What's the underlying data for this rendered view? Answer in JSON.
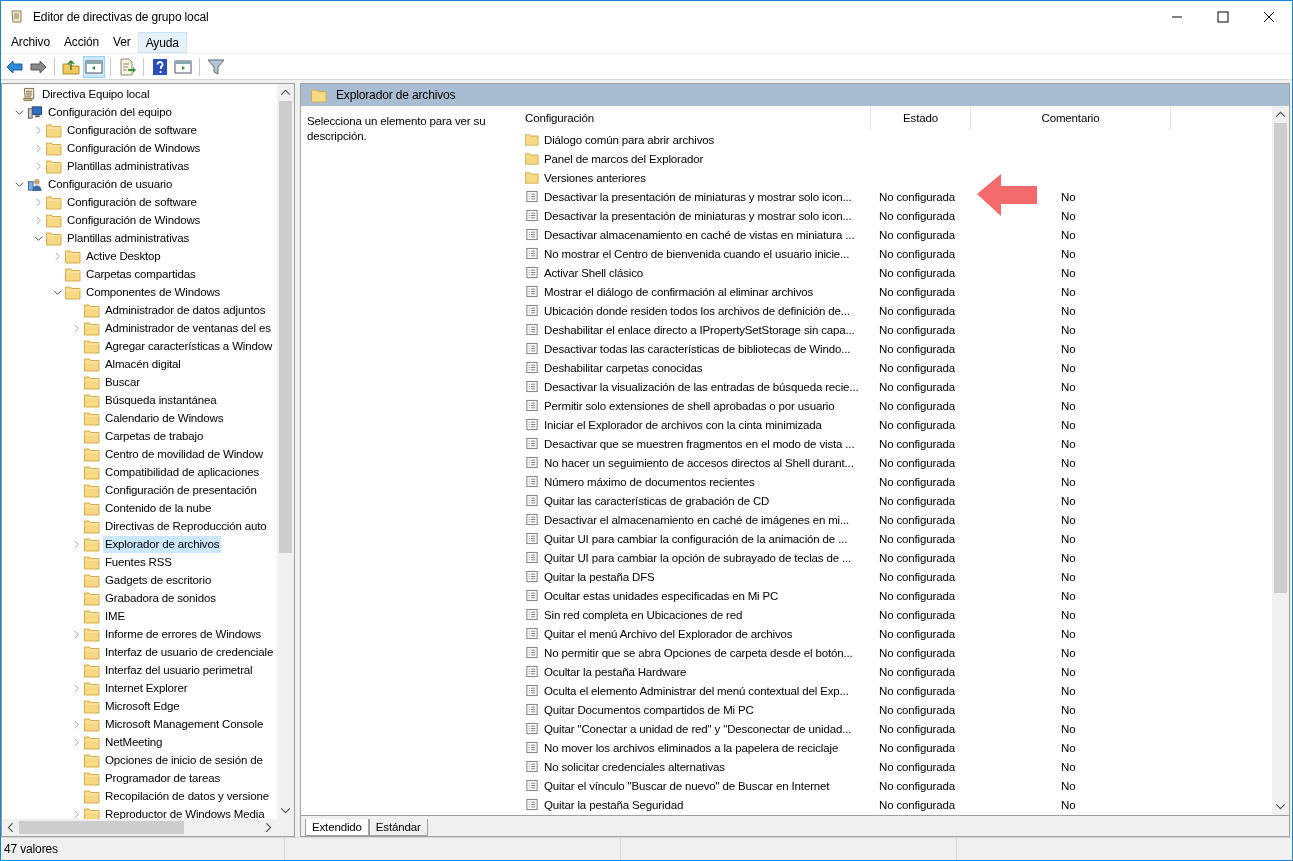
{
  "window": {
    "title": "Editor de directivas de grupo local"
  },
  "menu": [
    {
      "label": "Archivo",
      "highlighted": false
    },
    {
      "label": "Acción",
      "highlighted": false
    },
    {
      "label": "Ver",
      "highlighted": false
    },
    {
      "label": "Ayuda",
      "highlighted": true
    }
  ],
  "toolbar": [
    [
      {
        "pressed": false
      },
      {
        "pressed": false
      }
    ],
    [
      {
        "pressed": false
      },
      {
        "pressed": true
      }
    ],
    [
      {
        "pressed": false
      }
    ],
    [
      {
        "pressed": false
      },
      {
        "pressed": false
      }
    ],
    [
      {
        "pressed": false
      }
    ]
  ],
  "tree": [
    {
      "label": "Directiva Equipo local",
      "kind": "scroll",
      "selected": false,
      "children": [
        {
          "label": "Configuración del equipo",
          "kind": "computer",
          "expanded": true,
          "selected": false,
          "children": [
            {
              "label": "Configuración de software",
              "kind": "folder",
              "expanded": false,
              "selected": false
            },
            {
              "label": "Configuración de Windows",
              "kind": "folder",
              "expanded": false,
              "selected": false
            },
            {
              "label": "Plantillas administrativas",
              "kind": "folder",
              "expanded": false,
              "selected": false
            }
          ]
        },
        {
          "label": "Configuración de usuario",
          "kind": "user",
          "expanded": true,
          "selected": false,
          "children": [
            {
              "label": "Configuración de software",
              "kind": "folder",
              "expanded": false,
              "selected": false
            },
            {
              "label": "Configuración de Windows",
              "kind": "folder",
              "expanded": false,
              "selected": false
            },
            {
              "label": "Plantillas administrativas",
              "kind": "folder",
              "expanded": true,
              "selected": false,
              "children": [
                {
                  "label": "Active Desktop",
                  "kind": "folder",
                  "expanded": false,
                  "selected": false
                },
                {
                  "label": "Carpetas compartidas",
                  "kind": "folder",
                  "selected": false
                },
                {
                  "label": "Componentes de Windows",
                  "kind": "folder",
                  "expanded": true,
                  "selected": false,
                  "children": [
                    {
                      "label": "Administrador de datos adjuntos",
                      "kind": "folder",
                      "selected": false
                    },
                    {
                      "label": "Administrador de ventanas del es",
                      "kind": "folder",
                      "expanded": false,
                      "selected": false
                    },
                    {
                      "label": "Agregar características a Window",
                      "kind": "folder",
                      "selected": false
                    },
                    {
                      "label": "Almacén digital",
                      "kind": "folder",
                      "selected": false
                    },
                    {
                      "label": "Buscar",
                      "kind": "folder",
                      "selected": false
                    },
                    {
                      "label": "Búsqueda instantánea",
                      "kind": "folder",
                      "selected": false
                    },
                    {
                      "label": "Calendario de Windows",
                      "kind": "folder",
                      "selected": false
                    },
                    {
                      "label": "Carpetas de trabajo",
                      "kind": "folder",
                      "selected": false
                    },
                    {
                      "label": "Centro de movilidad de Window",
                      "kind": "folder",
                      "selected": false
                    },
                    {
                      "label": "Compatibilidad de aplicaciones",
                      "kind": "folder",
                      "selected": false
                    },
                    {
                      "label": "Configuración de presentación",
                      "kind": "folder",
                      "selected": false
                    },
                    {
                      "label": "Contenido de la nube",
                      "kind": "folder",
                      "selected": false
                    },
                    {
                      "label": "Directivas de Reproducción auto",
                      "kind": "folder",
                      "selected": false
                    },
                    {
                      "label": "Explorador de archivos",
                      "kind": "folder",
                      "expanded": false,
                      "selected": true
                    },
                    {
                      "label": "Fuentes RSS",
                      "kind": "folder",
                      "selected": false
                    },
                    {
                      "label": "Gadgets de escritorio",
                      "kind": "folder",
                      "selected": false
                    },
                    {
                      "label": "Grabadora de sonidos",
                      "kind": "folder",
                      "selected": false
                    },
                    {
                      "label": "IME",
                      "kind": "folder",
                      "selected": false
                    },
                    {
                      "label": "Informe de errores de Windows",
                      "kind": "folder",
                      "expanded": false,
                      "selected": false
                    },
                    {
                      "label": "Interfaz de usuario de credenciale",
                      "kind": "folder",
                      "selected": false
                    },
                    {
                      "label": "Interfaz del usuario perimetral",
                      "kind": "folder",
                      "selected": false
                    },
                    {
                      "label": "Internet Explorer",
                      "kind": "folder",
                      "expanded": false,
                      "selected": false
                    },
                    {
                      "label": "Microsoft Edge",
                      "kind": "folder",
                      "selected": false
                    },
                    {
                      "label": "Microsoft Management Console",
                      "kind": "folder",
                      "expanded": false,
                      "selected": false
                    },
                    {
                      "label": "NetMeeting",
                      "kind": "folder",
                      "expanded": false,
                      "selected": false
                    },
                    {
                      "label": "Opciones de inicio de sesión de",
                      "kind": "folder",
                      "selected": false
                    },
                    {
                      "label": "Programador de tareas",
                      "kind": "folder",
                      "selected": false
                    },
                    {
                      "label": "Recopilación de datos y versione",
                      "kind": "folder",
                      "selected": false
                    },
                    {
                      "label": "Reproductor de Windows Media",
                      "kind": "folder",
                      "expanded": false,
                      "selected": false
                    }
                  ]
                }
              ]
            }
          ]
        }
      ]
    }
  ],
  "details": {
    "title": "Explorador de archivos",
    "description": "Selecciona un elemento para ver su descripción.",
    "columns": [
      "Configuración",
      "Estado",
      "Comentario"
    ],
    "rows": [
      {
        "kind": "folder",
        "name": "Diálogo común para abrir archivos"
      },
      {
        "kind": "folder",
        "name": "Panel de marcos del Explorador"
      },
      {
        "kind": "folder",
        "name": "Versiones anteriores"
      },
      {
        "kind": "policy",
        "name": "Desactivar la presentación de miniaturas y mostrar solo icon...",
        "state": "No configurada",
        "comment": "No"
      },
      {
        "kind": "policy",
        "name": "Desactivar la presentación de miniaturas y mostrar solo icon...",
        "state": "No configurada",
        "comment": "No"
      },
      {
        "kind": "policy",
        "name": "Desactivar almacenamiento en caché de vistas en miniatura ...",
        "state": "No configurada",
        "comment": "No"
      },
      {
        "kind": "policy",
        "name": "No mostrar el Centro de bienvenida cuando el usuario inicie...",
        "state": "No configurada",
        "comment": "No"
      },
      {
        "kind": "policy",
        "name": "Activar Shell clásico",
        "state": "No configurada",
        "comment": "No"
      },
      {
        "kind": "policy",
        "name": "Mostrar el diálogo de confirmación al eliminar archivos",
        "state": "No configurada",
        "comment": "No"
      },
      {
        "kind": "policy",
        "name": "Ubicación donde residen todos los archivos de definición de...",
        "state": "No configurada",
        "comment": "No"
      },
      {
        "kind": "policy",
        "name": "Deshabilitar el enlace directo a IPropertySetStorage sin capa...",
        "state": "No configurada",
        "comment": "No"
      },
      {
        "kind": "policy",
        "name": "Desactivar todas las características de bibliotecas de Windo...",
        "state": "No configurada",
        "comment": "No"
      },
      {
        "kind": "policy",
        "name": "Deshabilitar carpetas conocidas",
        "state": "No configurada",
        "comment": "No"
      },
      {
        "kind": "policy",
        "name": "Desactivar la visualización de las entradas de búsqueda recie...",
        "state": "No configurada",
        "comment": "No"
      },
      {
        "kind": "policy",
        "name": "Permitir solo extensiones de shell aprobadas o por usuario",
        "state": "No configurada",
        "comment": "No"
      },
      {
        "kind": "policy",
        "name": "Iniciar el Explorador de archivos con la cinta minimizada",
        "state": "No configurada",
        "comment": "No"
      },
      {
        "kind": "policy",
        "name": "Desactivar que se muestren fragmentos en el modo de vista ...",
        "state": "No configurada",
        "comment": "No"
      },
      {
        "kind": "policy",
        "name": "No hacer un seguimiento de accesos directos al Shell durant...",
        "state": "No configurada",
        "comment": "No"
      },
      {
        "kind": "policy",
        "name": "Número máximo de documentos recientes",
        "state": "No configurada",
        "comment": "No"
      },
      {
        "kind": "policy",
        "name": "Quitar las características de grabación de CD",
        "state": "No configurada",
        "comment": "No"
      },
      {
        "kind": "policy",
        "name": "Desactivar el almacenamiento en caché de imágenes en mi...",
        "state": "No configurada",
        "comment": "No"
      },
      {
        "kind": "policy",
        "name": "Quitar UI para cambiar la configuración de la animación de ...",
        "state": "No configurada",
        "comment": "No"
      },
      {
        "kind": "policy",
        "name": "Quitar UI para cambiar la opción de subrayado de teclas de ...",
        "state": "No configurada",
        "comment": "No"
      },
      {
        "kind": "policy",
        "name": "Quitar la pestaña DFS",
        "state": "No configurada",
        "comment": "No"
      },
      {
        "kind": "policy",
        "name": "Ocultar estas unidades especificadas en Mi PC",
        "state": "No configurada",
        "comment": "No"
      },
      {
        "kind": "policy",
        "name": "Sin red completa en Ubicaciones de red",
        "state": "No configurada",
        "comment": "No"
      },
      {
        "kind": "policy",
        "name": "Quitar el menú Archivo del Explorador de archivos",
        "state": "No configurada",
        "comment": "No"
      },
      {
        "kind": "policy",
        "name": "No permitir que se abra Opciones de carpeta desde el botón...",
        "state": "No configurada",
        "comment": "No"
      },
      {
        "kind": "policy",
        "name": "Ocultar la pestaña Hardware",
        "state": "No configurada",
        "comment": "No"
      },
      {
        "kind": "policy",
        "name": "Oculta el elemento Administrar del menú contextual del Exp...",
        "state": "No configurada",
        "comment": "No"
      },
      {
        "kind": "policy",
        "name": "Quitar Documentos compartidos de Mi PC",
        "state": "No configurada",
        "comment": "No"
      },
      {
        "kind": "policy",
        "name": "Quitar \"Conectar a unidad de red\" y \"Desconectar de unidad...",
        "state": "No configurada",
        "comment": "No"
      },
      {
        "kind": "policy",
        "name": "No mover los archivos eliminados a la papelera de reciclaje",
        "state": "No configurada",
        "comment": "No"
      },
      {
        "kind": "policy",
        "name": "No solicitar credenciales alternativas",
        "state": "No configurada",
        "comment": "No"
      },
      {
        "kind": "policy",
        "name": "Quitar el vínculo \"Buscar de nuevo\" de Buscar en Internet",
        "state": "No configurada",
        "comment": "No"
      },
      {
        "kind": "policy",
        "name": "Quitar la pestaña Seguridad",
        "state": "No configurada",
        "comment": "No"
      }
    ]
  },
  "view_tabs": [
    {
      "label": "Extendido",
      "selected": true
    },
    {
      "label": "Estándar",
      "selected": false
    }
  ],
  "status_bar": {
    "text": "47 valores"
  }
}
